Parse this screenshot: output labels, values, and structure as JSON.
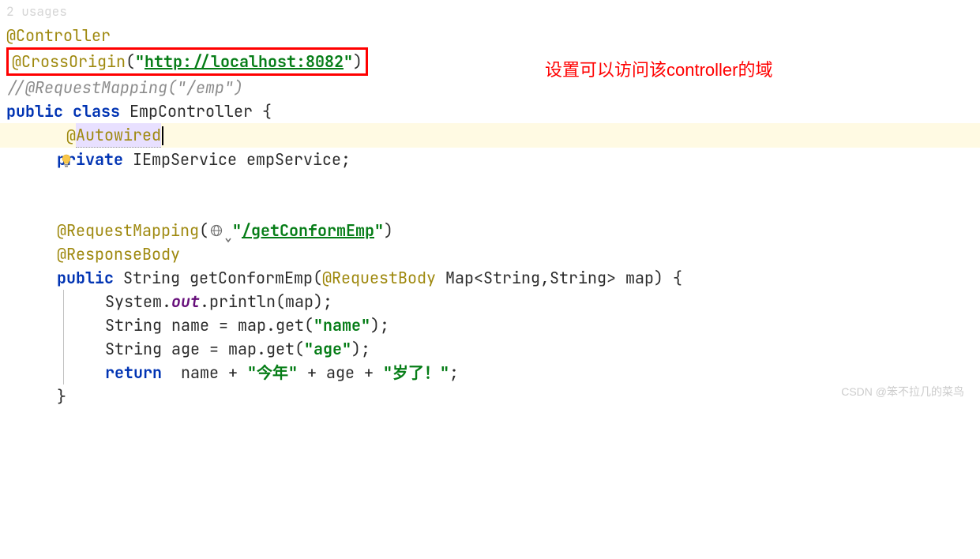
{
  "hints": {
    "usages": "2 usages"
  },
  "annotations": {
    "controller": "@Controller",
    "crossOrigin": "@CrossOrigin",
    "autowired": "Autowired",
    "requestMapping": "@RequestMapping",
    "responseBody": "@ResponseBody",
    "requestBody": "@RequestBody"
  },
  "strings": {
    "crossOriginUrl": "http://localhost:8082",
    "getConformEmp": "/getConformEmp",
    "name": "name",
    "age": "age",
    "thisYear": "今年",
    "yearsOld": "岁了！"
  },
  "comment": "//@RequestMapping(\"/emp\")",
  "keywords": {
    "public": "public",
    "class": "class",
    "private": "private",
    "return": "return"
  },
  "identifiers": {
    "className": "EmpController",
    "serviceType": "IEmpService",
    "serviceField": "empService",
    "stringType": "String",
    "methodName": "getConformEmp",
    "mapType": "Map",
    "mapParam": "map",
    "system": "System",
    "out": "out",
    "println": "println",
    "nameVar": "name",
    "ageVar": "age",
    "get": "get"
  },
  "redAnnotation": "设置可以访问该controller的域",
  "watermark": "CSDN @笨不拉几的菜鸟",
  "icons": {
    "bulb": "lightbulb-icon",
    "globe": "globe-icon",
    "chevron": "chevron-down-icon"
  }
}
